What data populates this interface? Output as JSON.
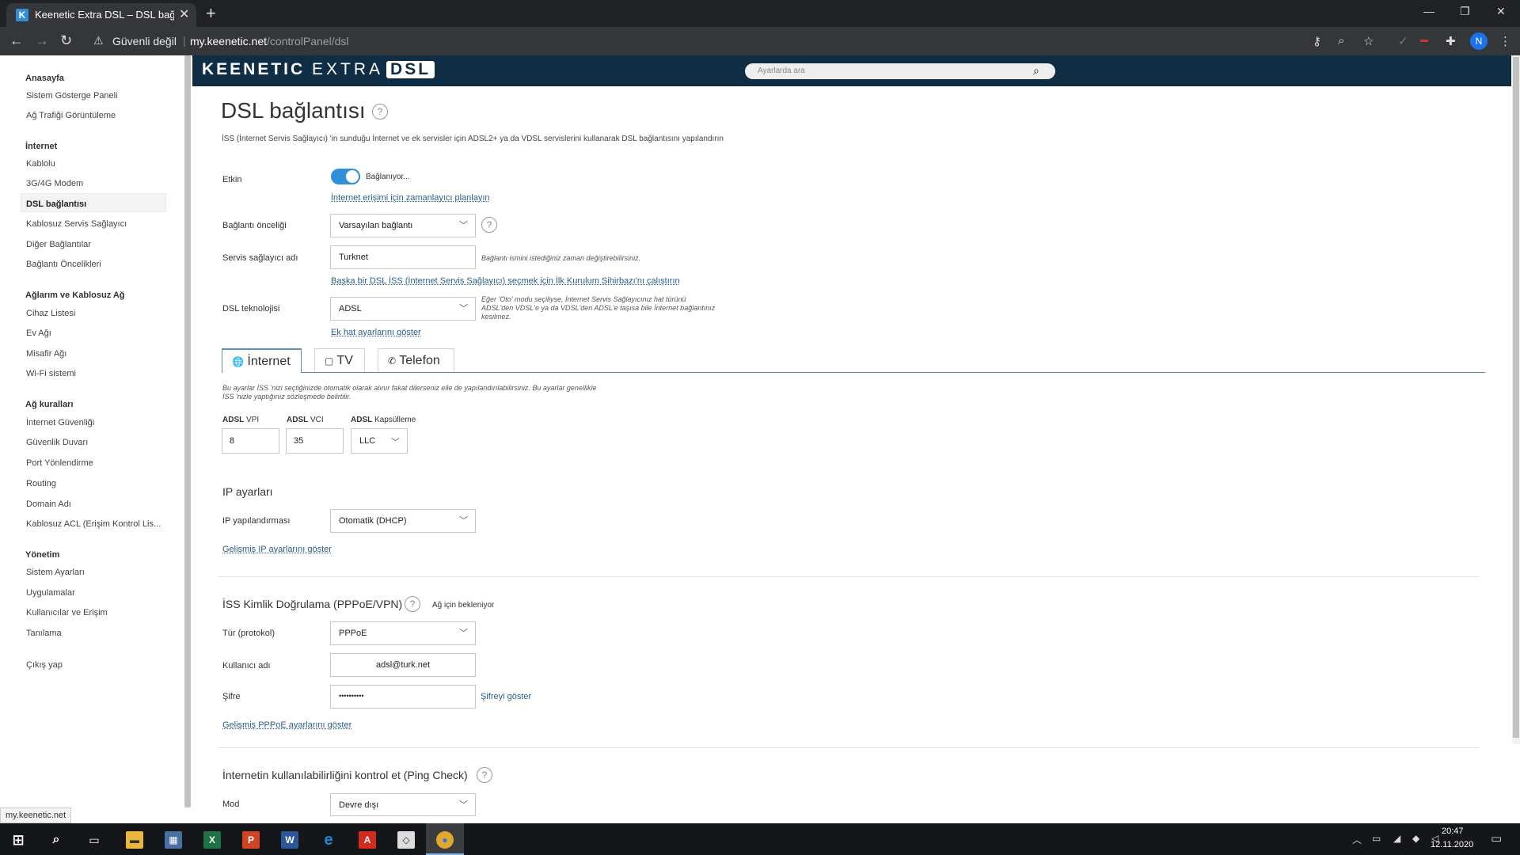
{
  "browser": {
    "tab_title": "Keenetic Extra DSL – DSL bağlantı",
    "tab_favicon": "K",
    "new_tab": "+",
    "security_label": "Güvenli değil",
    "url_host": "my.keenetic.net",
    "url_path": "/controlPanel/dsl",
    "profile_initial": "N",
    "status_url": "my.keenetic.net"
  },
  "sidebar": {
    "groups": [
      {
        "title": "Anasayfa",
        "items": [
          "Sistem Gösterge Paneli",
          "Ağ Trafiği Görüntüleme"
        ]
      },
      {
        "title": "İnternet",
        "items": [
          "Kablolu",
          "3G/4G Modem",
          "DSL bağlantısı",
          "Kablosuz Servis Sağlayıcı",
          "Diğer Bağlantılar",
          "Bağlantı Öncelikleri"
        ]
      },
      {
        "title": "Ağlarım ve Kablosuz Ağ",
        "items": [
          "Cihaz Listesi",
          "Ev Ağı",
          "Misafir Ağı",
          "Wi-Fi sistemi"
        ]
      },
      {
        "title": "Ağ kuralları",
        "items": [
          "İnternet Güvenliği",
          "Güvenlik Duvarı",
          "Port Yönlendirme",
          "Routing",
          "Domain Adı",
          "Kablosuz ACL (Erişim Kontrol Lis..."
        ]
      },
      {
        "title": "Yönetim",
        "items": [
          "Sistem Ayarları",
          "Uygulamalar",
          "Kullanıcılar ve Erişim",
          "Tanılama"
        ]
      }
    ],
    "logout": "Çıkış yap",
    "active": "DSL bağlantısı"
  },
  "header": {
    "logo_bold": "KEENETIC",
    "logo_thin": "EXTRA",
    "logo_box": "DSL",
    "search_placeholder": "Ayarlarda ara"
  },
  "page": {
    "title": "DSL bağlantısı",
    "description": "İSS (İnternet Servis Sağlayıcı) 'in sunduğu İnternet ve ek servisler için ADSL2+ ya da VDSL servislerini kullanarak DSL bağlantısını yapılandırın",
    "enabled_label": "Etkin",
    "enabled_status": "Bağlanıyor...",
    "schedule_link": "İnternet erişimi için zamanlayıcı planlayın",
    "priority_label": "Bağlantı önceliği",
    "priority_value": "Varsayılan bağlantı",
    "provider_label": "Servis sağlayıcı adı",
    "provider_value": "Turknet",
    "provider_hint": "Bağlantı ismini istediğiniz zaman değiştirebilirsiniz.",
    "wizard_link": "Başka bir DSL İSS (İnternet Servis Sağlayıcı) seçmek için İlk Kurulum Sihirbazı'nı çalıştırın",
    "dsltech_label": "DSL teknolojisi",
    "dsltech_value": "ADSL",
    "dsltech_hint": "Eğer 'Oto' modu seçiliyse, İnternet Servis Sağlayıcınız hat türünü ADSL'den VDSL'e ya da VDSL'den ADSL'e taşısa bile İnternet bağlantınız kesilmez.",
    "extra_line_link": "Ek hat ayarlarını göster",
    "tabs": [
      {
        "icon": "🌐",
        "label": "İnternet"
      },
      {
        "icon": "▢",
        "label": "TV"
      },
      {
        "icon": "✆",
        "label": "Telefon"
      }
    ],
    "tab_hint": "Bu ayarlar İSS 'nizi seçtiğinizde otomatik olarak alınır fakat dilerseniz elle de yapılandırılabilirsiniz. Bu ayarlar genellikle İSS 'nizle yaptığınız sözleşmede belirtilir.",
    "vpi_label_bold": "ADSL",
    "vpi_label": "VPI",
    "vpi_value": "8",
    "vci_label_bold": "ADSL",
    "vci_label": "VCI",
    "vci_value": "35",
    "encap_label_bold": "ADSL",
    "encap_label": "Kapsülleme",
    "encap_value": "LLC",
    "ip_section": "IP ayarları",
    "ip_config_label": "IP yapılandırması",
    "ip_config_value": "Otomatik (DHCP)",
    "ip_adv_link": "Gelişmiş IP ayarlarını göster",
    "auth_section": "İSS Kimlik Doğrulama (PPPoE/VPN)",
    "auth_status": "Ağ için bekleniyor",
    "type_label": "Tür (protokol)",
    "type_value": "PPPoE",
    "user_label": "Kullanıcı adı",
    "user_value": "adsl@turk.net",
    "pass_label": "Şifre",
    "pass_value": "••••••••••",
    "show_pass": "Şifreyi göster",
    "pppoe_adv_link": "Gelişmiş PPPoE ayarlarını göster",
    "ping_section": "İnternetin kullanılabilirliğini kontrol et (Ping Check)",
    "mode_label": "Mod",
    "mode_value": "Devre dışı"
  },
  "taskbar": {
    "time": "20:47",
    "date": "12.11.2020"
  },
  "colors": {
    "header_bg": "#0f2d44",
    "toggle_on": "#2f8fd8",
    "link": "#2a5f8d"
  }
}
